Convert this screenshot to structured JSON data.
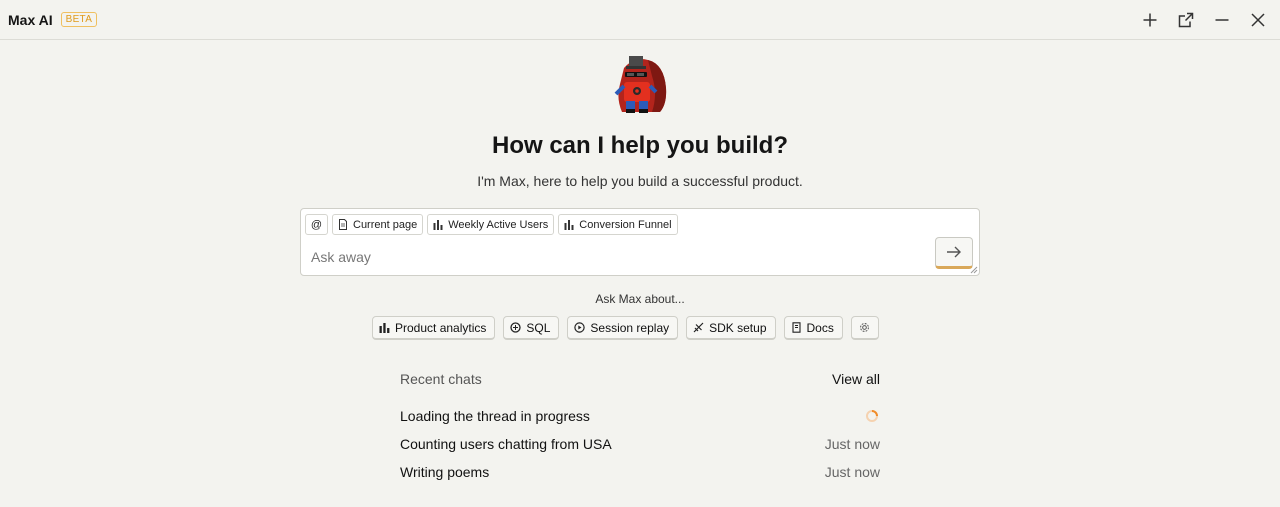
{
  "header": {
    "app_title": "Max AI",
    "badge": "BETA",
    "actions": [
      "plus-icon",
      "open-external-icon",
      "minimize-icon",
      "close-icon"
    ]
  },
  "hero": {
    "headline": "How can I help you build?",
    "subline": "I'm Max, here to help you build a successful product."
  },
  "composer": {
    "mention_label": "@",
    "context_chips": [
      {
        "label": "Current page",
        "icon": "page-icon"
      },
      {
        "label": "Weekly Active Users",
        "icon": "bar-chart-icon"
      },
      {
        "label": "Conversion Funnel",
        "icon": "bar-chart-icon"
      }
    ],
    "placeholder": "Ask away",
    "value": ""
  },
  "suggestions": {
    "title": "Ask Max about...",
    "items": [
      {
        "label": "Product analytics",
        "icon": "bar-chart-icon"
      },
      {
        "label": "SQL",
        "icon": "database-icon"
      },
      {
        "label": "Session replay",
        "icon": "play-icon"
      },
      {
        "label": "SDK setup",
        "icon": "plug-icon"
      },
      {
        "label": "Docs",
        "icon": "book-icon"
      },
      {
        "label": "",
        "icon": "gear-icon"
      }
    ]
  },
  "recent": {
    "title": "Recent chats",
    "view_all": "View all",
    "chats": [
      {
        "title": "Loading the thread in progress",
        "status": "loading"
      },
      {
        "title": "Counting users chatting from USA",
        "time": "Just now"
      },
      {
        "title": "Writing poems",
        "time": "Just now"
      }
    ]
  },
  "colors": {
    "background": "#f3f3ef",
    "accent": "#e09a1a",
    "send_underline": "#d9a85a",
    "spinner": "#f08c2a"
  }
}
